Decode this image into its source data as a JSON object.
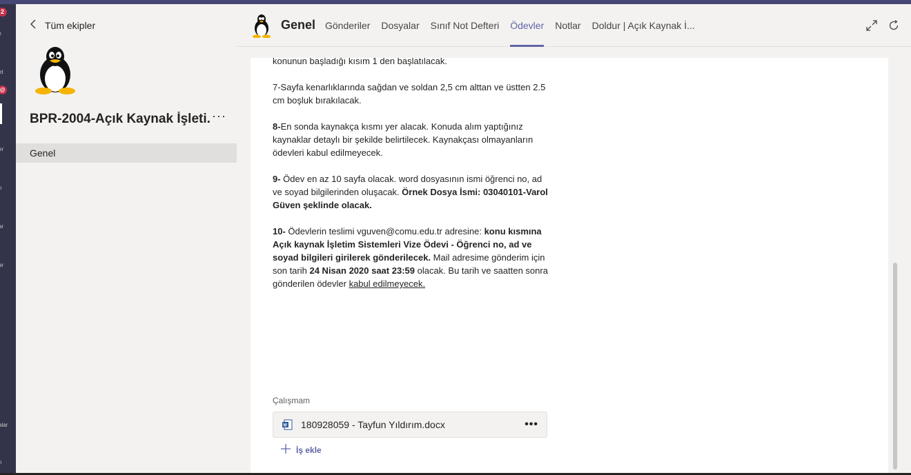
{
  "rail": {
    "badge_count": "2",
    "labels": [
      "k",
      "et",
      "er",
      "n",
      "ar",
      "ar",
      "alar",
      "n"
    ],
    "mention_badge": "@",
    "active_label": "r"
  },
  "team_panel": {
    "back_label": "Tüm ekipler",
    "team_name": "BPR-2004-Açık Kaynak İşleti...",
    "more_label": "···",
    "channels": [
      {
        "label": "Genel"
      }
    ]
  },
  "header": {
    "channel_title": "Genel",
    "tabs": [
      {
        "label": "Gönderiler"
      },
      {
        "label": "Dosyalar"
      },
      {
        "label": "Sınıf Not Defteri"
      },
      {
        "label": "Ödevler"
      },
      {
        "label": "Notlar"
      },
      {
        "label": "Doldur | Açık Kaynak İ..."
      }
    ],
    "active_tab": "Ödevler"
  },
  "assignment": {
    "p0": "konunun başladığı kısım 1 den başlatılacak.",
    "p1": "7-Sayfa kenarlıklarında sağdan ve soldan 2,5 cm alttan ve üstten 2.5 cm boşluk bırakılacak.",
    "p2_num": "8-",
    "p2": "En sonda kaynakça kısmı yer alacak. Konuda alım yaptığınız kaynaklar detaylı bir şekilde belirtilecek. Kaynakçası olmayanların ödevleri kabul edilmeyecek.",
    "p3_num": "9-",
    "p3": " Ödev en az 10 sayfa olacak. word dosyasının ismi öğrenci no, ad ve soyad bilgilerinden oluşacak. ",
    "p3_bold": "Örnek Dosya İsmi: 03040101-Varol Güven  şeklinde olacak.",
    "p4_num": "10-",
    "p4_a": " Ödevlerin teslimi  vguven@comu.edu.tr adresine: ",
    "p4_bold1": "konu kısmına Açık kaynak İşletim Sistemleri Vize Ödevi - Öğrenci no, ad ve soyad bilgileri girilerek gönderilecek.",
    "p4_b": " Mail adresime gönderim için son tarih  ",
    "p4_bold2": "24 Nisan 2020 saat 23:59",
    "p4_c": " olacak. Bu tarih ve saatten sonra gönderilen ödevler ",
    "p4_underline": "kabul edilmeyecek."
  },
  "work": {
    "label": "Çalışmam",
    "file_name": "180928059 - Tayfun Yıldırım.docx",
    "file_more": "•••",
    "add_label": "İş ekle"
  },
  "colors": {
    "accent": "#6264a7",
    "rail": "#33344a",
    "badge": "#c4314b"
  }
}
